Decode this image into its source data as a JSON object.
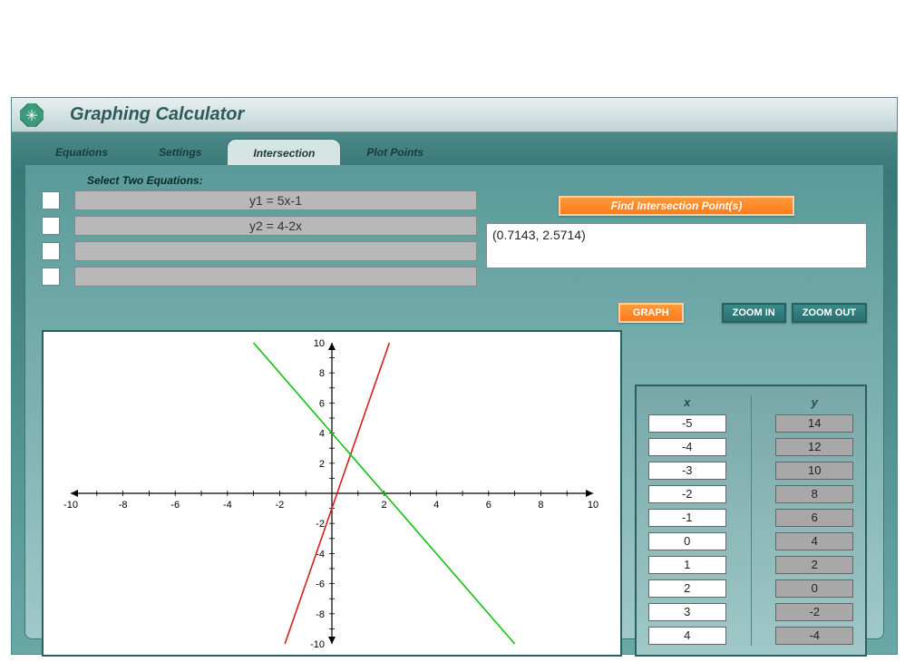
{
  "app_title": "Graphing Calculator",
  "tabs": {
    "equations": "Equations",
    "settings": "Settings",
    "intersection": "Intersection",
    "plot_points": "Plot Points"
  },
  "eq_section_label": "Select Two Equations:",
  "equations": {
    "e1": "y1 = 5x-1",
    "e2": "y2 = 4-2x",
    "e3": "",
    "e4": ""
  },
  "buttons": {
    "find": "Find Intersection Point(s)",
    "graph": "GRAPH",
    "zoom_in": "ZOOM IN",
    "zoom_out": "ZOOM OUT"
  },
  "result_text": "(0.7143, 2.5714)",
  "table": {
    "x_header": "x",
    "y_header": "y",
    "x": [
      "-5",
      "-4",
      "-3",
      "-2",
      "-1",
      "0",
      "1",
      "2",
      "3",
      "4"
    ],
    "y": [
      "14",
      "12",
      "10",
      "8",
      "6",
      "4",
      "2",
      "0",
      "-2",
      "-4"
    ]
  },
  "chart_data": {
    "type": "line",
    "xlabel": "",
    "ylabel": "",
    "xlim": [
      -10,
      10
    ],
    "ylim": [
      -10,
      10
    ],
    "x_ticks": [
      -10,
      -8,
      -6,
      -4,
      -2,
      2,
      4,
      6,
      8,
      10
    ],
    "y_ticks": [
      -10,
      -8,
      -6,
      -4,
      -2,
      2,
      4,
      6,
      8,
      10
    ],
    "series": [
      {
        "name": "y1 = 5x-1",
        "color": "#d02020",
        "points": [
          [
            -1.8,
            -10
          ],
          [
            2.2,
            10
          ]
        ]
      },
      {
        "name": "y2 = 4-2x",
        "color": "#10c010",
        "points": [
          [
            -3,
            10
          ],
          [
            7,
            -10
          ]
        ]
      }
    ],
    "intersection": [
      0.7143,
      2.5714
    ]
  }
}
